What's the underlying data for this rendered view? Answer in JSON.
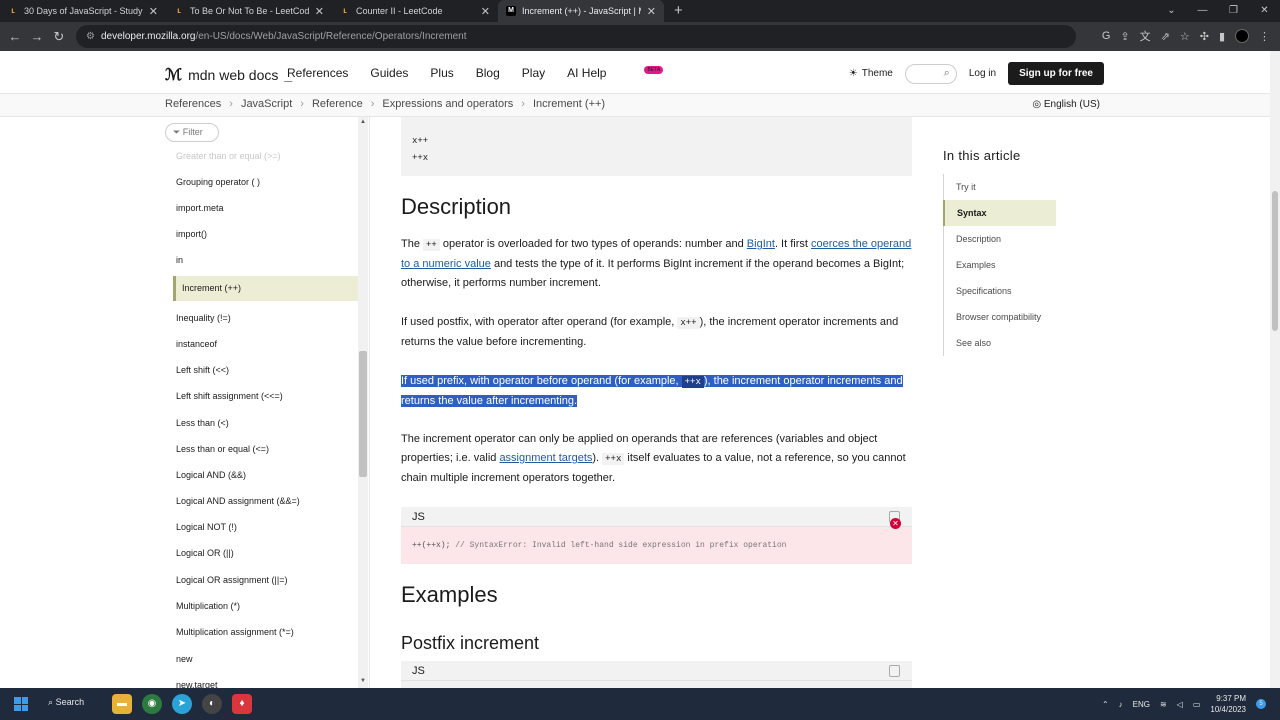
{
  "browser": {
    "tabs": [
      {
        "title": "30 Days of JavaScript - Study Pl",
        "favicon": "leetcode-icon"
      },
      {
        "title": "To Be Or Not To Be - LeetCode",
        "favicon": "leetcode-icon"
      },
      {
        "title": "Counter II - LeetCode",
        "favicon": "leetcode-icon"
      },
      {
        "title": "Increment (++) - JavaScript | MD",
        "favicon": "mdn-icon"
      }
    ],
    "url_host": "developer.mozilla.org",
    "url_path": "/en-US/docs/Web/JavaScript/Reference/Operators/Increment"
  },
  "header": {
    "logo_text": "mdn web docs",
    "nav": [
      "References",
      "Guides",
      "Plus",
      "Blog",
      "Play",
      "AI Help"
    ],
    "beta_badge": "BETA",
    "theme_label": "Theme",
    "login_label": "Log in",
    "signup_label": "Sign up for free"
  },
  "breadcrumbs": [
    "References",
    "JavaScript",
    "Reference",
    "Expressions and operators",
    "Increment (++)"
  ],
  "language": "English (US)",
  "sidebar": {
    "filter_placeholder": "Filter",
    "items": [
      "Greater than or equal (>=)",
      "Grouping operator ( )",
      "import.meta",
      "import()",
      "in",
      "Increment (++)",
      "Inequality (!=)",
      "instanceof",
      "Left shift (<<)",
      "Left shift assignment (<<=)",
      "Less than (<)",
      "Less than or equal (<=)",
      "Logical AND (&&)",
      "Logical AND assignment (&&=)",
      "Logical NOT (!)",
      "Logical OR (||)",
      "Logical OR assignment (||=)",
      "Multiplication (*)",
      "Multiplication assignment (*=)",
      "new",
      "new.target"
    ]
  },
  "main": {
    "syntax_code": [
      "x++",
      "++x"
    ],
    "description_heading": "Description",
    "p1": {
      "a": "The ",
      "code": "++",
      "b": " operator is overloaded for two types of operands: number and ",
      "link1": "BigInt",
      "c": ". It first ",
      "link2": "coerces the operand to a numeric value",
      "d": " and tests the type of it. It performs BigInt increment if the operand becomes a BigInt; otherwise, it performs number increment."
    },
    "p2": {
      "a": "If used postfix, with operator after operand (for example, ",
      "code": "x++",
      "b": "), the increment operator increments and returns the value before incrementing."
    },
    "p3": {
      "a": "If used prefix, with operator before operand (for example, ",
      "code": "++x",
      "b": "), the increment operator increments and returns the value after incrementing."
    },
    "p4": {
      "a": "The increment operator can only be applied on operands that are references (variables and object properties; i.e. valid ",
      "link": "assignment targets",
      "b": "). ",
      "code": "++x",
      "c": " itself evaluates to a value, not a reference, so you cannot chain multiple increment operators together."
    },
    "error_code_lang": "JS",
    "error_code": "++(++x);",
    "error_comment": " // SyntaxError: Invalid left-hand side expression in prefix operation",
    "examples_heading": "Examples",
    "postfix_heading": "Postfix increment",
    "postfix_code_lang": "JS"
  },
  "toc": {
    "title": "In this article",
    "items": [
      "Try it",
      "Syntax",
      "Description",
      "Examples",
      "Specifications",
      "Browser compatibility",
      "See also"
    ]
  },
  "taskbar": {
    "search_label": "Search",
    "lang": "ENG",
    "time": "9:37 PM",
    "date": "10/4/2023",
    "notif_count": "5"
  },
  "colors": {
    "selection": "#2f5fc4",
    "active_bg": "#ecedd5",
    "link": "#1f5ba4"
  }
}
